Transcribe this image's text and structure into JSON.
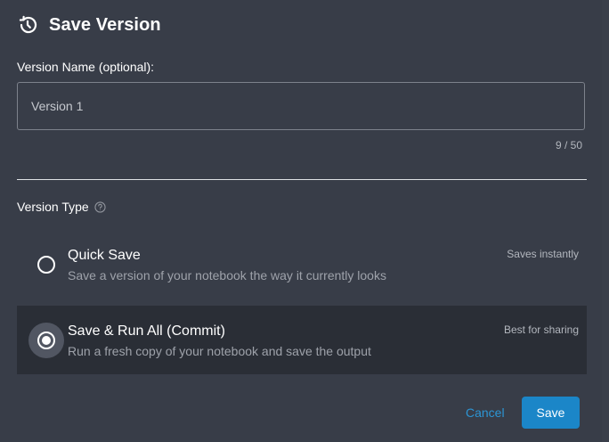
{
  "dialog": {
    "title": "Save Version",
    "title_icon": "history-clock-icon"
  },
  "version_name": {
    "label": "Version Name (optional):",
    "value": "Version 1",
    "char_count": "9 / 50"
  },
  "version_type": {
    "label": "Version Type",
    "help_icon": "help-circle-icon",
    "selected": "commit",
    "options": [
      {
        "id": "quick",
        "title": "Quick Save",
        "description": "Save a version of your notebook the way it currently looks",
        "hint": "Saves instantly"
      },
      {
        "id": "commit",
        "title": "Save & Run All (Commit)",
        "description": "Run a fresh copy of your notebook and save the output",
        "hint": "Best for sharing"
      }
    ]
  },
  "actions": {
    "cancel_label": "Cancel",
    "save_label": "Save"
  },
  "colors": {
    "background": "#383d48",
    "selected_option_bg": "#2a2e36",
    "accent": "#1b86c8",
    "link": "#2c95d4"
  }
}
